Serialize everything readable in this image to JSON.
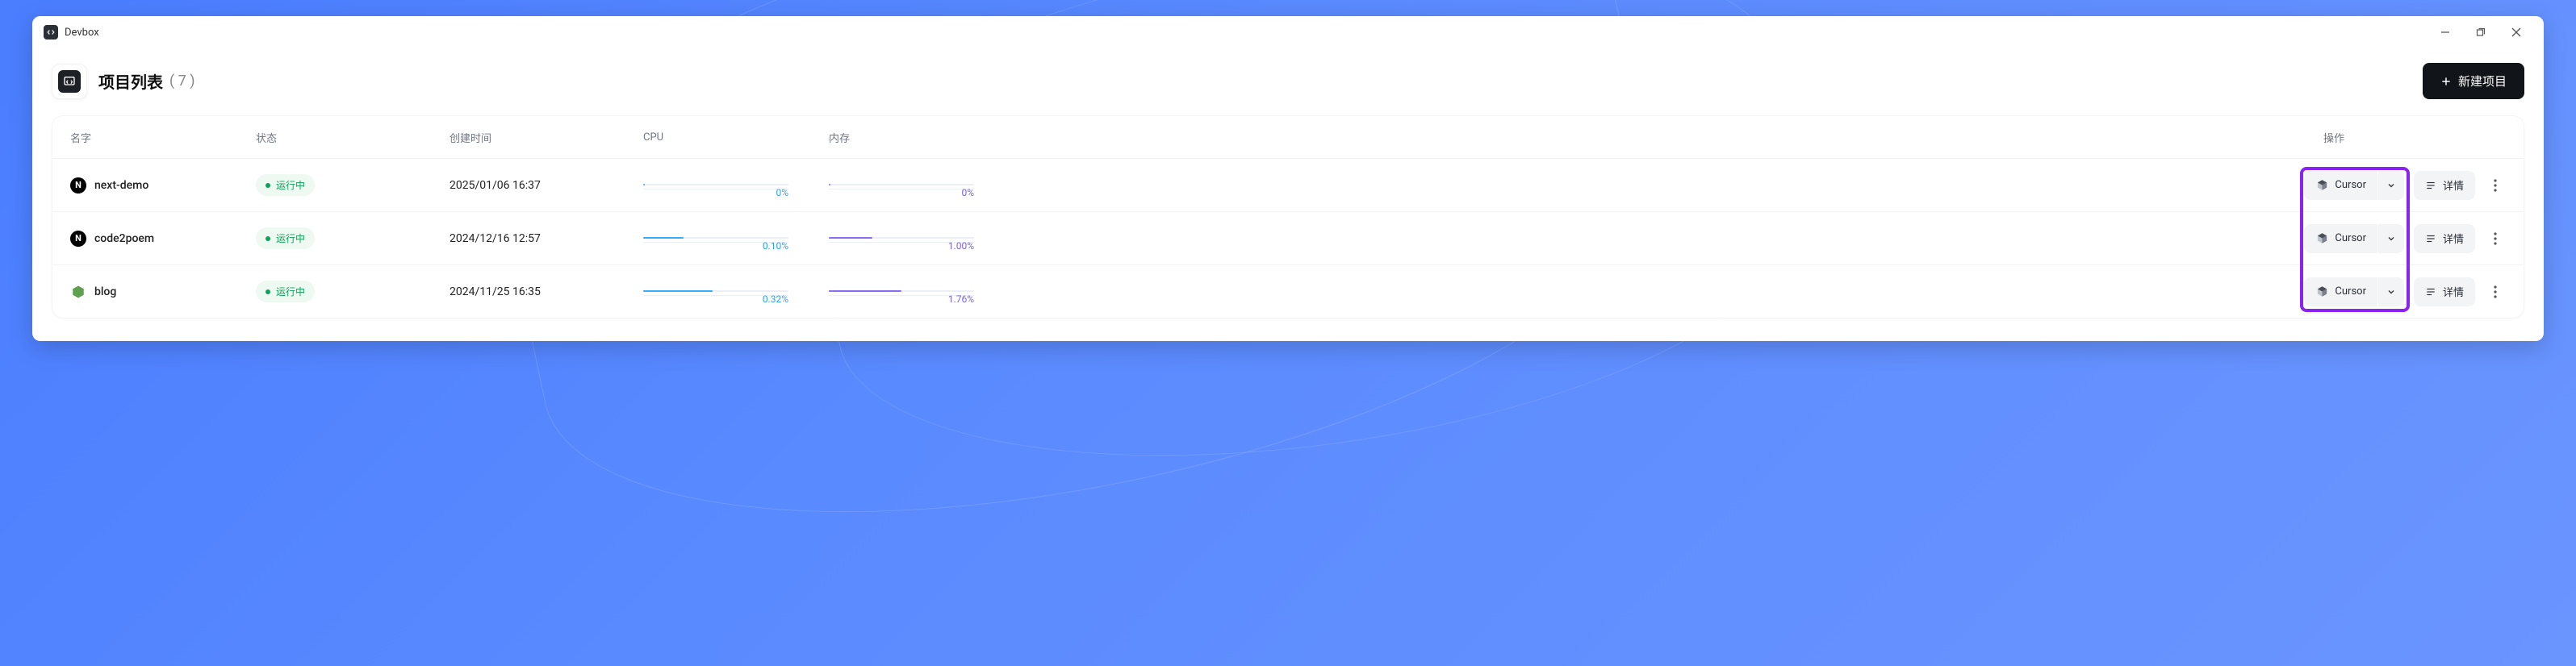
{
  "window": {
    "title": "Devbox"
  },
  "header": {
    "title": "项目列表",
    "count_label": "( 7 )",
    "new_button": "新建项目"
  },
  "columns": {
    "name": "名字",
    "status": "状态",
    "created": "创建时间",
    "cpu": "CPU",
    "memory": "内存",
    "ops": "操作"
  },
  "status_running": "运行中",
  "ide_label": "Cursor",
  "detail_label": "详情",
  "rows": [
    {
      "icon": "next",
      "name": "next-demo",
      "created": "2025/01/06 16:37",
      "cpu_pct": "0%",
      "cpu_width": "1%",
      "mem_pct": "0%",
      "mem_width": "1%"
    },
    {
      "icon": "next",
      "name": "code2poem",
      "created": "2024/12/16 12:57",
      "cpu_pct": "0.10%",
      "cpu_width": "28%",
      "mem_pct": "1.00%",
      "mem_width": "30%"
    },
    {
      "icon": "node",
      "name": "blog",
      "created": "2024/11/25 16:35",
      "cpu_pct": "0.32%",
      "cpu_width": "48%",
      "mem_pct": "1.76%",
      "mem_width": "50%"
    }
  ]
}
